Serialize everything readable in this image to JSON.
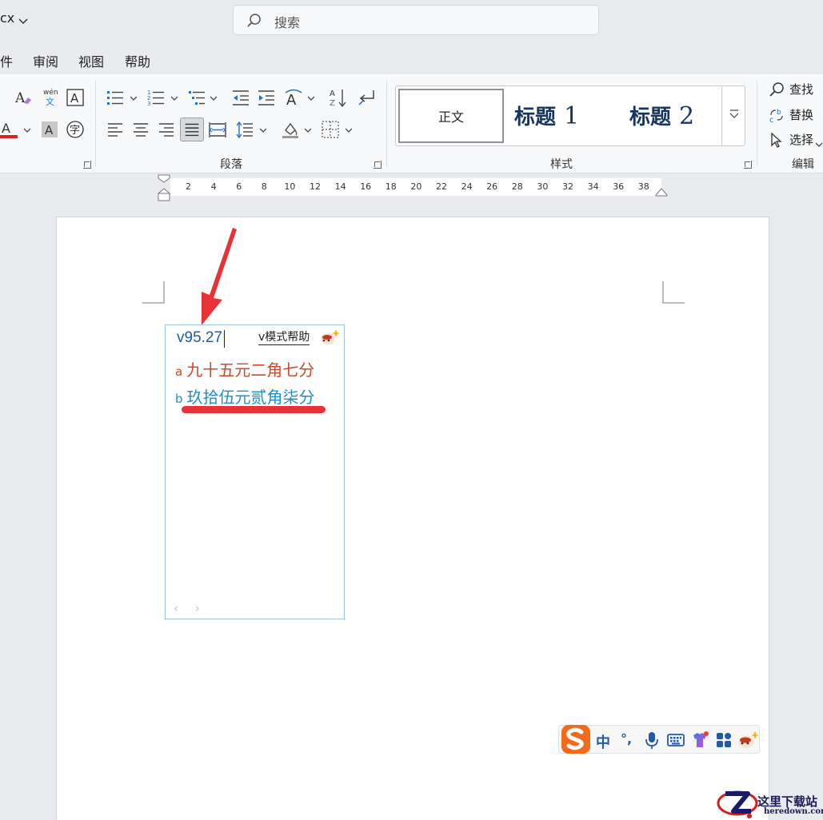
{
  "title_bar": {
    "doc_name": "cx",
    "search_placeholder": "搜索"
  },
  "menu": {
    "items": [
      "件",
      "审阅",
      "视图",
      "帮助"
    ]
  },
  "ribbon": {
    "groups": {
      "paragraph": "段落",
      "styles": "样式",
      "editing": "编辑"
    },
    "styles": {
      "normal": "正文",
      "heading1": "标题",
      "heading1_num": "1",
      "heading2": "标题",
      "heading2_num": "2"
    },
    "editing": {
      "find": "查找",
      "replace": "替换",
      "select": "选择"
    },
    "phonetic_label": "wén",
    "phonetic_char": "文",
    "font_color_letter": "A",
    "shade_letter": "A",
    "enclose_char": "字",
    "accent_colors": {
      "font_color_bar": "#e02020",
      "heading": "#17365d"
    }
  },
  "ruler": {
    "ticks": [
      "2",
      "4",
      "6",
      "8",
      "10",
      "12",
      "14",
      "16",
      "18",
      "20",
      "22",
      "24",
      "26",
      "28",
      "30",
      "32",
      "34",
      "36",
      "38"
    ]
  },
  "ime": {
    "input": "v95.27",
    "help": "v模式帮助",
    "candidates": [
      {
        "key": "a",
        "text": "九十五元二角七分"
      },
      {
        "key": "b",
        "text": "玖拾伍元贰角柒分"
      }
    ],
    "pager": "‹ ›"
  },
  "sogou_toolbar": {
    "lang": "中",
    "punct": "°,"
  },
  "watermark": {
    "name": "这里下载站",
    "domain": "heredown.com"
  }
}
